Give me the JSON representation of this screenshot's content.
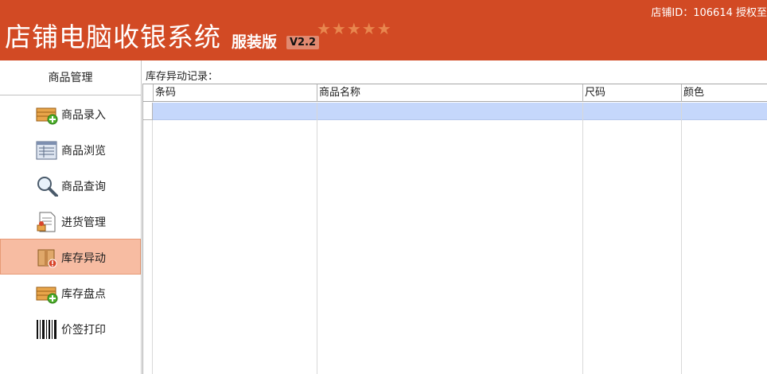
{
  "header": {
    "title": "店铺电脑收银系统",
    "edition": "服装版",
    "version": "V2.2",
    "stars": "★★★★★",
    "store_info": "店铺ID：106614 授权至"
  },
  "sidebar": {
    "heading": "商品管理",
    "items": [
      {
        "label": "商品录入",
        "icon": "box-add-icon"
      },
      {
        "label": "商品浏览",
        "icon": "list-view-icon"
      },
      {
        "label": "商品查询",
        "icon": "magnifier-icon"
      },
      {
        "label": "进货管理",
        "icon": "document-stamp-icon"
      },
      {
        "label": "库存异动",
        "icon": "package-alert-icon"
      },
      {
        "label": "库存盘点",
        "icon": "box-add-icon"
      },
      {
        "label": "价签打印",
        "icon": "barcode-icon"
      }
    ],
    "active_index": 4
  },
  "main": {
    "section_title": "库存异动记录：",
    "columns": [
      "条码",
      "商品名称",
      "尺码",
      "颜色"
    ]
  },
  "colors": {
    "header_bg": "#d24a24",
    "active_item_bg": "#f7bca2",
    "selected_row_bg": "#c5d7fb"
  }
}
